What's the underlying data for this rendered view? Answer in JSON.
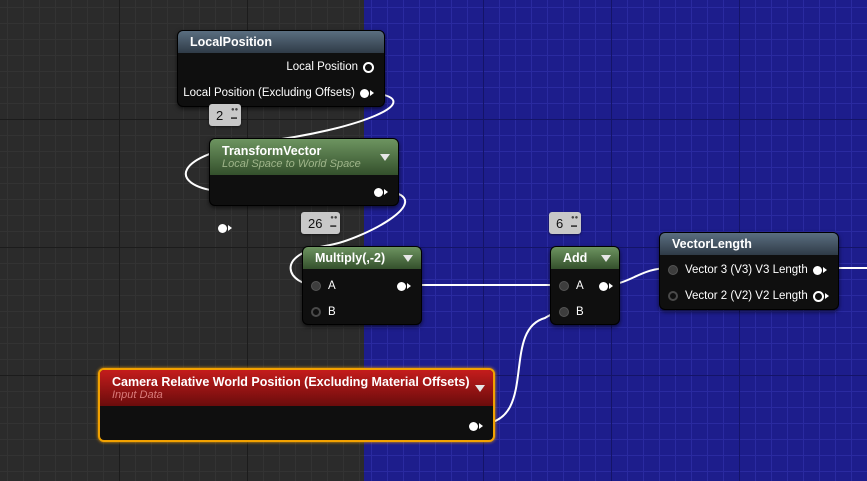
{
  "graph": {
    "nodes": {
      "local_position": {
        "title": "LocalPosition",
        "outputs": [
          "Local Position",
          "Local Position (Excluding Offsets)"
        ]
      },
      "transform_vector": {
        "title": "TransformVector",
        "subtitle": "Local Space to World Space",
        "badge": "2"
      },
      "multiply": {
        "title": "Multiply(,-2)",
        "inputs": [
          "A",
          "B"
        ],
        "badge": "26"
      },
      "add": {
        "title": "Add",
        "inputs": [
          "A",
          "B"
        ],
        "badge": "6"
      },
      "vector_length": {
        "title": "VectorLength",
        "outputs": [
          "Vector 3 (V3) V3 Length",
          "Vector 2 (V2) V2 Length"
        ]
      },
      "camera_relative": {
        "title": "Camera Relative World Position (Excluding Material Offsets)",
        "subtitle": "Input Data"
      }
    }
  },
  "colors": {
    "canvas_left": "#2b2b2b",
    "canvas_right": "#1d1d8c",
    "selection": "#f2a100",
    "header_green": "#6d9460",
    "header_red": "#c41c1c",
    "header_grey": "#5a6e80"
  },
  "icons": [
    "dropdown-chevron-icon",
    "output-pin-icon",
    "input-pin-icon",
    "stats-badge-icon"
  ]
}
